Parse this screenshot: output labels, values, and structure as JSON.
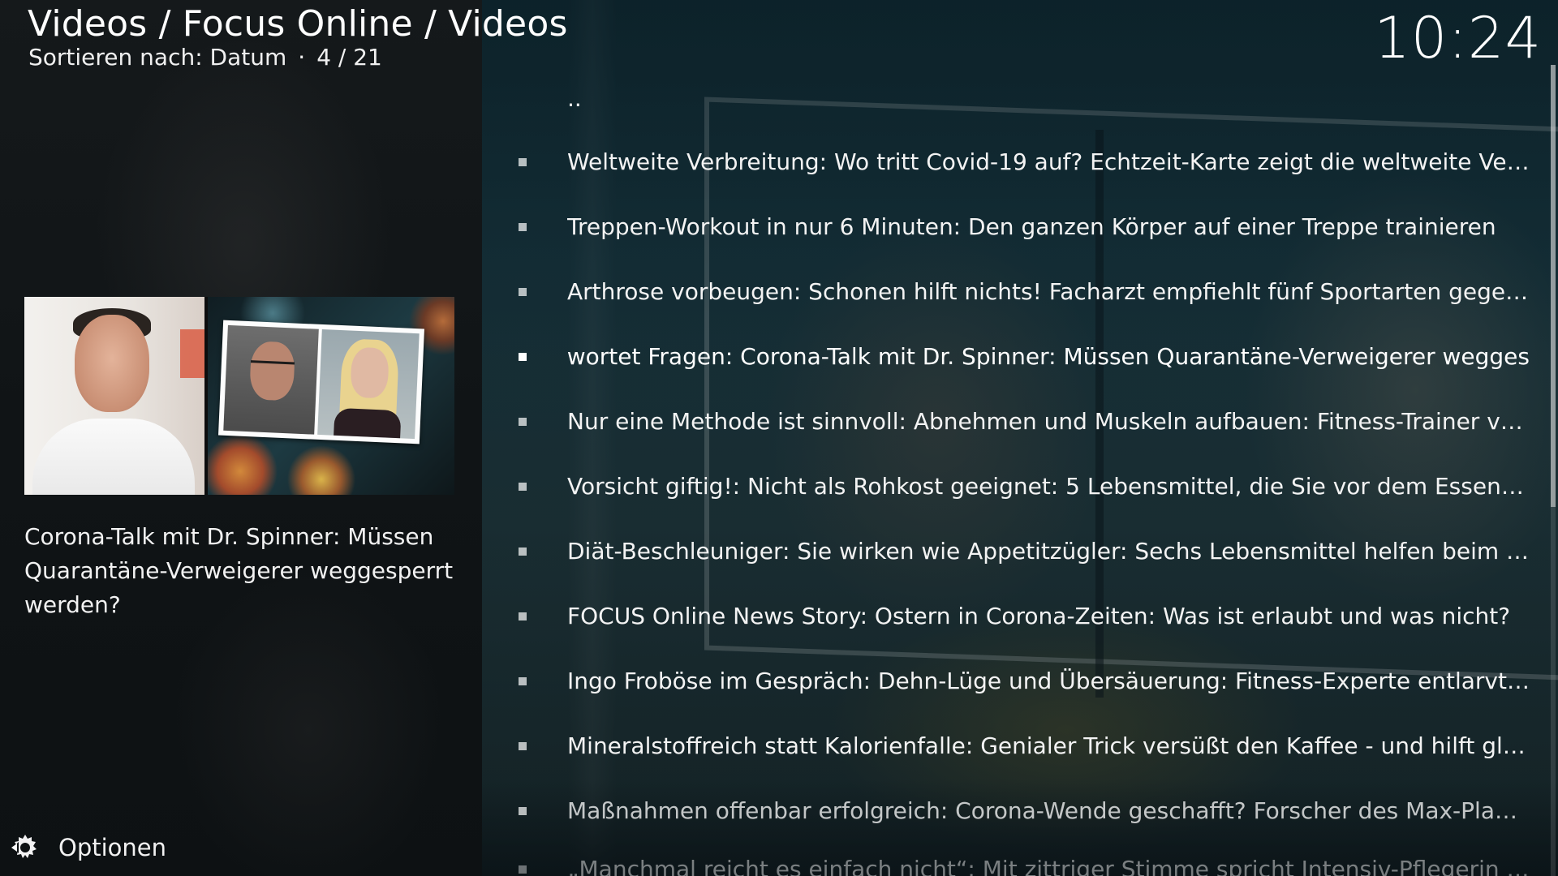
{
  "header": {
    "breadcrumb": "Videos / Focus Online / Videos",
    "sort_label": "Sortieren nach: Datum",
    "separator": "·",
    "position": "4 / 21",
    "clock": "10:24"
  },
  "info_panel": {
    "plot": "Corona-Talk mit Dr. Spinner: Müssen Quarantäne-Verweigerer weggesperrt werden?"
  },
  "list": {
    "parent_label": "..",
    "items": [
      {
        "title": "Weltweite Verbreitung: Wo tritt Covid-19 auf? Echtzeit-Karte zeigt die weltweite Verbreitung"
      },
      {
        "title": "Treppen-Workout in nur 6 Minuten: Den ganzen Körper auf einer Treppe trainieren"
      },
      {
        "title": "Arthrose vorbeugen: Schonen hilft nichts! Facharzt empfiehlt fünf Sportarten gegen Gelenkschmerzen"
      },
      {
        "title": "antwortet Fragen: Corona-Talk mit Dr. Spinner: Müssen Quarantäne-Verweigerer wegges"
      },
      {
        "title": "Nur eine Methode ist sinnvoll: Abnehmen und Muskeln aufbauen: Fitness-Trainer verrät"
      },
      {
        "title": "Vorsicht giftig!: Nicht als Rohkost geeignet: 5 Lebensmittel, die Sie vor dem Essen garen"
      },
      {
        "title": "Diät-Beschleuniger: Sie wirken wie Appetitzügler: Sechs Lebensmittel helfen beim Abnehmen"
      },
      {
        "title": "FOCUS Online News Story: Ostern in Corona-Zeiten: Was ist erlaubt und was nicht?"
      },
      {
        "title": "Ingo Froböse im Gespräch: Dehn-Lüge und Übersäuerung: Fitness-Experte entlarvt größte"
      },
      {
        "title": "Mineralstoffreich statt Kalorienfalle: Genialer Trick versüßt den Kaffee - und hilft gleichzeitig"
      },
      {
        "title": "Maßnahmen offenbar erfolgreich: Corona-Wende geschafft? Forscher des Max-Planck-Instituts"
      },
      {
        "title": "„Manchmal reicht es einfach nicht“: Mit zittriger Stimme spricht Intensiv-Pflegerin aus"
      }
    ],
    "focused_index": 3
  },
  "footer": {
    "options_label": "Optionen",
    "options_icon": "options-gear-icon"
  },
  "scroll": {
    "position_fraction": 0.19
  }
}
